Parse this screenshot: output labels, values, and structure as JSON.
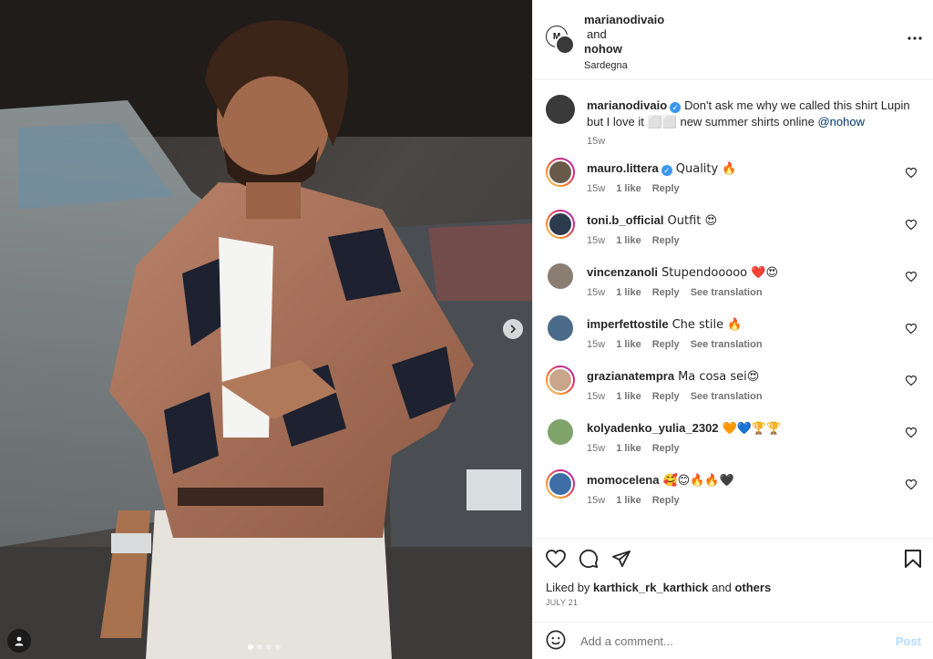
{
  "header": {
    "user1": "marianodivaio",
    "and": "and",
    "user2": "nohow",
    "location": "Sardegna",
    "avatar_letter": "M"
  },
  "caption": {
    "user": "marianodivaio",
    "text": "Don't ask me why we called this shirt Lupin but I love it ⬜⬜ new summer shirts online ",
    "mention": "@nohow",
    "time": "15w"
  },
  "comments": [
    {
      "user": "mauro.littera",
      "verified": true,
      "text": "Quality 🔥",
      "time": "15w",
      "likes": "1 like",
      "reply": "Reply",
      "translate": "",
      "ring": true,
      "avatar_color": "#6a5a4a"
    },
    {
      "user": "toni.b_official",
      "verified": false,
      "text": "Outfit 😍",
      "time": "15w",
      "likes": "1 like",
      "reply": "Reply",
      "translate": "",
      "ring": true,
      "avatar_color": "#2d3b4e"
    },
    {
      "user": "vincenzanoli",
      "verified": false,
      "text": "Stupendooooo ❤️😍",
      "time": "15w",
      "likes": "1 like",
      "reply": "Reply",
      "translate": "See translation",
      "ring": false,
      "avatar_color": "#8a7d72"
    },
    {
      "user": "imperfettostile",
      "verified": false,
      "text": "Che stile 🔥",
      "time": "15w",
      "likes": "1 like",
      "reply": "Reply",
      "translate": "See translation",
      "ring": false,
      "avatar_color": "#4b6b8a"
    },
    {
      "user": "grazianatempra",
      "verified": false,
      "text": "Ma cosa sei😍",
      "time": "15w",
      "likes": "1 like",
      "reply": "Reply",
      "translate": "See translation",
      "ring": true,
      "avatar_color": "#c9a58a"
    },
    {
      "user": "kolyadenko_yulia_2302",
      "verified": false,
      "text": "🧡💙🏆🏆",
      "time": "15w",
      "likes": "1 like",
      "reply": "Reply",
      "translate": "",
      "ring": false,
      "avatar_color": "#7fa36a"
    },
    {
      "user": "momocelena",
      "verified": false,
      "text": "🥰😊🔥🔥🖤",
      "time": "15w",
      "likes": "1 like",
      "reply": "Reply",
      "translate": "",
      "ring": true,
      "avatar_color": "#3f6ea6"
    }
  ],
  "footer": {
    "liked_by_prefix": "Liked by ",
    "liked_by_user": "karthick_rk_karthick",
    "and_word": " and ",
    "others": "others",
    "date": "JULY 21",
    "comment_placeholder": "Add a comment...",
    "post_label": "Post"
  },
  "carousel": {
    "total": 4,
    "active_index": 0
  },
  "colors": {
    "accent": "#0095f6",
    "post_disabled": "#b3dbff",
    "muted": "#737373"
  },
  "icons": [
    "more-icon",
    "heart-icon",
    "comment-icon",
    "share-icon",
    "save-icon",
    "emoji-icon",
    "chevron-right-icon",
    "user-tag-icon"
  ]
}
